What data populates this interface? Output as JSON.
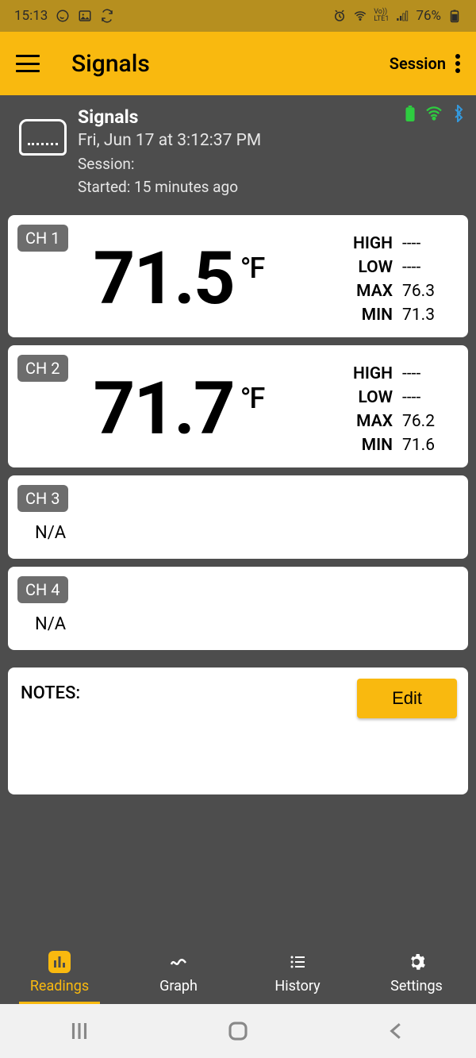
{
  "statusbar": {
    "time": "15:13",
    "battery": "76%"
  },
  "appbar": {
    "title": "Signals",
    "session": "Session"
  },
  "info": {
    "name": "Signals",
    "datetime": "Fri, Jun 17  at 3:12:37 PM",
    "session": "Session:",
    "started": "Started: 15 minutes ago"
  },
  "channels": [
    {
      "badge": "CH 1",
      "value": "71.5",
      "unit": "°F",
      "stats": {
        "high_l": "HIGH",
        "high_v": "----",
        "low_l": "LOW",
        "low_v": "----",
        "max_l": "MAX",
        "max_v": "76.3",
        "min_l": "MIN",
        "min_v": "71.3"
      }
    },
    {
      "badge": "CH 2",
      "value": "71.7",
      "unit": "°F",
      "stats": {
        "high_l": "HIGH",
        "high_v": "----",
        "low_l": "LOW",
        "low_v": "----",
        "max_l": "MAX",
        "max_v": "76.2",
        "min_l": "MIN",
        "min_v": "71.6"
      }
    },
    {
      "badge": "CH 3",
      "na": "N/A"
    },
    {
      "badge": "CH 4",
      "na": "N/A"
    }
  ],
  "notes": {
    "label": "NOTES:",
    "edit": "Edit"
  },
  "nav": {
    "readings": "Readings",
    "graph": "Graph",
    "history": "History",
    "settings": "Settings"
  }
}
